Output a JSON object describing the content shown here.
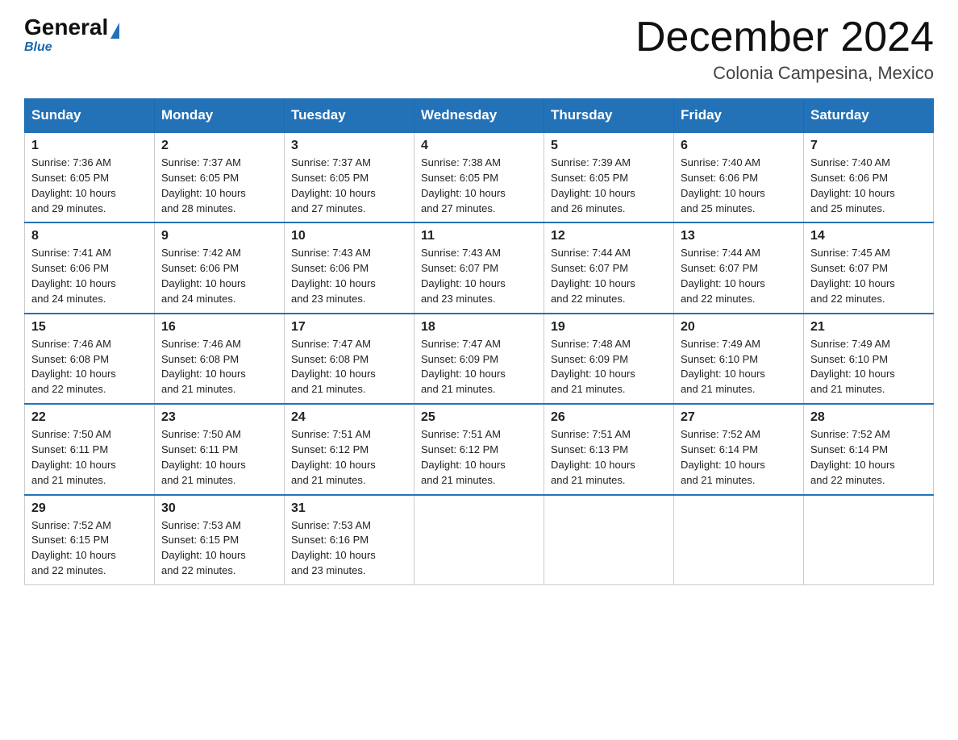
{
  "logo": {
    "general": "General",
    "blue": "Blue",
    "tagline": "Blue"
  },
  "title": "December 2024",
  "location": "Colonia Campesina, Mexico",
  "days_of_week": [
    "Sunday",
    "Monday",
    "Tuesday",
    "Wednesday",
    "Thursday",
    "Friday",
    "Saturday"
  ],
  "weeks": [
    [
      {
        "day": "1",
        "sunrise": "7:36 AM",
        "sunset": "6:05 PM",
        "daylight": "10 hours and 29 minutes."
      },
      {
        "day": "2",
        "sunrise": "7:37 AM",
        "sunset": "6:05 PM",
        "daylight": "10 hours and 28 minutes."
      },
      {
        "day": "3",
        "sunrise": "7:37 AM",
        "sunset": "6:05 PM",
        "daylight": "10 hours and 27 minutes."
      },
      {
        "day": "4",
        "sunrise": "7:38 AM",
        "sunset": "6:05 PM",
        "daylight": "10 hours and 27 minutes."
      },
      {
        "day": "5",
        "sunrise": "7:39 AM",
        "sunset": "6:05 PM",
        "daylight": "10 hours and 26 minutes."
      },
      {
        "day": "6",
        "sunrise": "7:40 AM",
        "sunset": "6:06 PM",
        "daylight": "10 hours and 25 minutes."
      },
      {
        "day": "7",
        "sunrise": "7:40 AM",
        "sunset": "6:06 PM",
        "daylight": "10 hours and 25 minutes."
      }
    ],
    [
      {
        "day": "8",
        "sunrise": "7:41 AM",
        "sunset": "6:06 PM",
        "daylight": "10 hours and 24 minutes."
      },
      {
        "day": "9",
        "sunrise": "7:42 AM",
        "sunset": "6:06 PM",
        "daylight": "10 hours and 24 minutes."
      },
      {
        "day": "10",
        "sunrise": "7:43 AM",
        "sunset": "6:06 PM",
        "daylight": "10 hours and 23 minutes."
      },
      {
        "day": "11",
        "sunrise": "7:43 AM",
        "sunset": "6:07 PM",
        "daylight": "10 hours and 23 minutes."
      },
      {
        "day": "12",
        "sunrise": "7:44 AM",
        "sunset": "6:07 PM",
        "daylight": "10 hours and 22 minutes."
      },
      {
        "day": "13",
        "sunrise": "7:44 AM",
        "sunset": "6:07 PM",
        "daylight": "10 hours and 22 minutes."
      },
      {
        "day": "14",
        "sunrise": "7:45 AM",
        "sunset": "6:07 PM",
        "daylight": "10 hours and 22 minutes."
      }
    ],
    [
      {
        "day": "15",
        "sunrise": "7:46 AM",
        "sunset": "6:08 PM",
        "daylight": "10 hours and 22 minutes."
      },
      {
        "day": "16",
        "sunrise": "7:46 AM",
        "sunset": "6:08 PM",
        "daylight": "10 hours and 21 minutes."
      },
      {
        "day": "17",
        "sunrise": "7:47 AM",
        "sunset": "6:08 PM",
        "daylight": "10 hours and 21 minutes."
      },
      {
        "day": "18",
        "sunrise": "7:47 AM",
        "sunset": "6:09 PM",
        "daylight": "10 hours and 21 minutes."
      },
      {
        "day": "19",
        "sunrise": "7:48 AM",
        "sunset": "6:09 PM",
        "daylight": "10 hours and 21 minutes."
      },
      {
        "day": "20",
        "sunrise": "7:49 AM",
        "sunset": "6:10 PM",
        "daylight": "10 hours and 21 minutes."
      },
      {
        "day": "21",
        "sunrise": "7:49 AM",
        "sunset": "6:10 PM",
        "daylight": "10 hours and 21 minutes."
      }
    ],
    [
      {
        "day": "22",
        "sunrise": "7:50 AM",
        "sunset": "6:11 PM",
        "daylight": "10 hours and 21 minutes."
      },
      {
        "day": "23",
        "sunrise": "7:50 AM",
        "sunset": "6:11 PM",
        "daylight": "10 hours and 21 minutes."
      },
      {
        "day": "24",
        "sunrise": "7:51 AM",
        "sunset": "6:12 PM",
        "daylight": "10 hours and 21 minutes."
      },
      {
        "day": "25",
        "sunrise": "7:51 AM",
        "sunset": "6:12 PM",
        "daylight": "10 hours and 21 minutes."
      },
      {
        "day": "26",
        "sunrise": "7:51 AM",
        "sunset": "6:13 PM",
        "daylight": "10 hours and 21 minutes."
      },
      {
        "day": "27",
        "sunrise": "7:52 AM",
        "sunset": "6:14 PM",
        "daylight": "10 hours and 21 minutes."
      },
      {
        "day": "28",
        "sunrise": "7:52 AM",
        "sunset": "6:14 PM",
        "daylight": "10 hours and 22 minutes."
      }
    ],
    [
      {
        "day": "29",
        "sunrise": "7:52 AM",
        "sunset": "6:15 PM",
        "daylight": "10 hours and 22 minutes."
      },
      {
        "day": "30",
        "sunrise": "7:53 AM",
        "sunset": "6:15 PM",
        "daylight": "10 hours and 22 minutes."
      },
      {
        "day": "31",
        "sunrise": "7:53 AM",
        "sunset": "6:16 PM",
        "daylight": "10 hours and 23 minutes."
      },
      null,
      null,
      null,
      null
    ]
  ],
  "labels": {
    "sunrise": "Sunrise:",
    "sunset": "Sunset:",
    "daylight": "Daylight:"
  }
}
